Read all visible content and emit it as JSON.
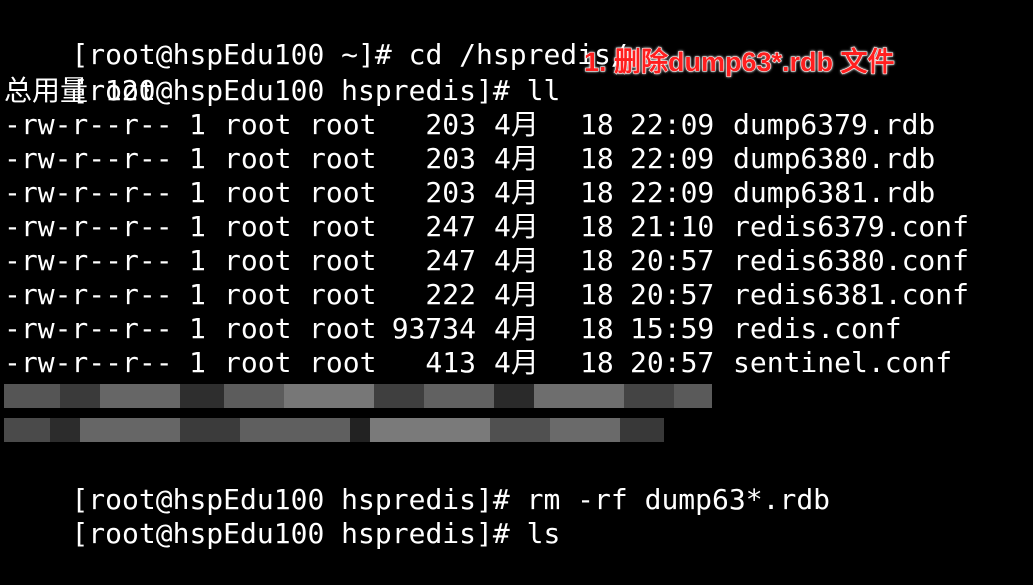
{
  "terminal": {
    "lines": [
      {
        "prompt": "[root@hspEdu100 ~]# ",
        "command": "cd /hspredis/"
      },
      {
        "prompt": "[root@hspEdu100 hspredis]# ",
        "command": "ll"
      },
      {
        "text": "总用量 120"
      },
      {
        "text": "rm -rf dump63*.rdb"
      },
      {
        "text": "ls"
      }
    ],
    "listing": [
      {
        "perms": "-rw-r--r--",
        "links": "1",
        "owner": "root",
        "group": "root",
        "size": "203",
        "month": "4月",
        "day": "18",
        "time": "22:09",
        "name": "dump6379.rdb"
      },
      {
        "perms": "-rw-r--r--",
        "links": "1",
        "owner": "root",
        "group": "root",
        "size": "203",
        "month": "4月",
        "day": "18",
        "time": "22:09",
        "name": "dump6380.rdb"
      },
      {
        "perms": "-rw-r--r--",
        "links": "1",
        "owner": "root",
        "group": "root",
        "size": "203",
        "month": "4月",
        "day": "18",
        "time": "22:09",
        "name": "dump6381.rdb"
      },
      {
        "perms": "-rw-r--r--",
        "links": "1",
        "owner": "root",
        "group": "root",
        "size": "247",
        "month": "4月",
        "day": "18",
        "time": "21:10",
        "name": "redis6379.conf"
      },
      {
        "perms": "-rw-r--r--",
        "links": "1",
        "owner": "root",
        "group": "root",
        "size": "247",
        "month": "4月",
        "day": "18",
        "time": "20:57",
        "name": "redis6380.conf"
      },
      {
        "perms": "-rw-r--r--",
        "links": "1",
        "owner": "root",
        "group": "root",
        "size": "222",
        "month": "4月",
        "day": "18",
        "time": "20:57",
        "name": "redis6381.conf"
      },
      {
        "perms": "-rw-r--r--",
        "links": "1",
        "owner": "root",
        "group": "root",
        "size": "93734",
        "month": "4月",
        "day": "18",
        "time": "15:59",
        "name": "redis.conf"
      },
      {
        "perms": "-rw-r--r--",
        "links": "1",
        "owner": "root",
        "group": "root",
        "size": "413",
        "month": "4月",
        "day": "18",
        "time": "20:57",
        "name": "sentinel.conf"
      }
    ],
    "rm_prompt": "[root@hspEdu100 hspredis]# ",
    "rm_command": "rm -rf dump63*.rdb",
    "ls_prompt": "[root@hspEdu100 hspredis]# ",
    "ls_command": "ls"
  },
  "annotation": {
    "text": "1. 删除dump63*.rdb 文件",
    "color": "#ff1f1f"
  },
  "colors": {
    "background": "#000000",
    "foreground": "#ffffff"
  }
}
